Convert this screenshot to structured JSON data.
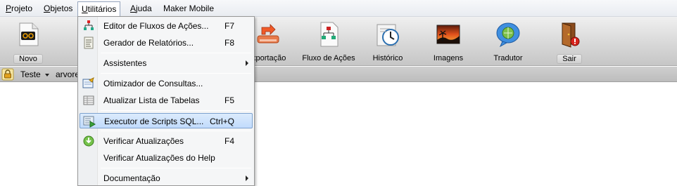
{
  "menubar": {
    "items": [
      {
        "label": "Projeto",
        "mnemonic": "P",
        "rest": "rojeto"
      },
      {
        "label": "Objetos",
        "mnemonic": "O",
        "rest": "bjetos"
      },
      {
        "label": "Utilitários",
        "mnemonic": "U",
        "rest": "tilitários"
      },
      {
        "label": "Ajuda",
        "mnemonic": "A",
        "rest": "juda"
      },
      {
        "label": "Maker Mobile"
      }
    ]
  },
  "toolbar": {
    "novo": "Novo",
    "exportacao": "xportação",
    "fluxo": "Fluxo de Ações",
    "historico": "Histórico",
    "imagens": "Imagens",
    "tradutor": "Tradutor",
    "sair": "Sair"
  },
  "tabs": {
    "teste": "Teste",
    "arvore": "arvore"
  },
  "dropdown": {
    "items": [
      {
        "label": "Editor de Fluxos de Ações...",
        "shortcut": "F7",
        "icon": "flow-editor-icon"
      },
      {
        "label": "Gerador de Relatórios...",
        "shortcut": "F8",
        "icon": "report-icon"
      },
      {
        "label": "Assistentes",
        "submenu": true
      },
      {
        "label": "Otimizador de Consultas...",
        "icon": "query-optimizer-icon"
      },
      {
        "label": "Atualizar Lista de Tabelas",
        "shortcut": "F5",
        "icon": "table-list-icon"
      },
      {
        "label": "Executor de Scripts SQL...",
        "shortcut": "Ctrl+Q",
        "icon": "sql-executor-icon",
        "highlighted": true
      },
      {
        "label": "Verificar Atualizações",
        "shortcut": "F4",
        "icon": "update-icon"
      },
      {
        "label": "Verificar Atualizações do Help"
      },
      {
        "label": "Documentação",
        "submenu": true
      }
    ]
  },
  "colors": {
    "highlight": "#c1dbfc",
    "highlight_border": "#7da2ce",
    "toolbar_bg": "#d8d8d8"
  }
}
